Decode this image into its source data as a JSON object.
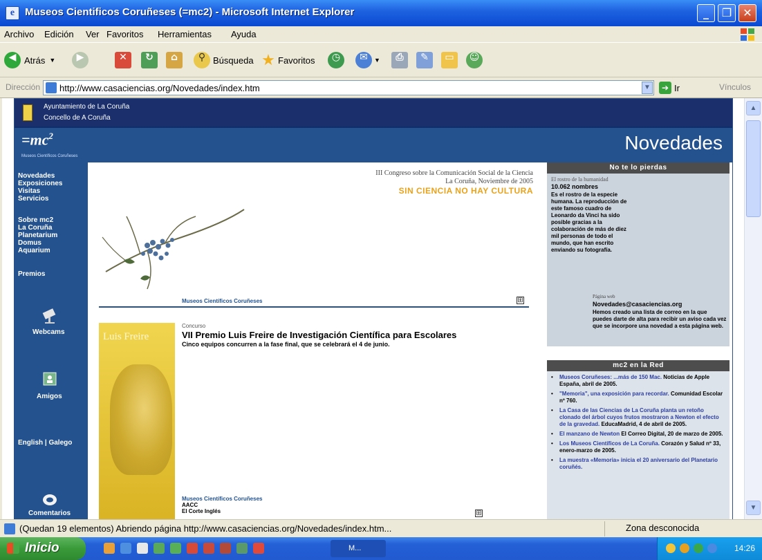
{
  "window": {
    "title": "Museos Cientificos Coruñeses (=mc2) - Microsoft Internet Explorer",
    "minimize": "_",
    "maximize": "❐",
    "close": "✕"
  },
  "menu": [
    "Archivo",
    "Edición",
    "Ver",
    "Favoritos",
    "Herramientas",
    "Ayuda"
  ],
  "toolbar": {
    "back": "Atrás",
    "search": "Búsqueda",
    "favorites": "Favoritos"
  },
  "address": {
    "label": "Dirección",
    "url": "http://www.casaciencias.org/Novedades/index.htm",
    "go": "Ir",
    "links": "Vínculos"
  },
  "site": {
    "org_line1": "Ayuntamiento de La Coruña",
    "org_line2": "Concello de A Coruña",
    "logo": "=mc",
    "logo_sup": "2",
    "logo_sub": "Museos Científicos Coruñeses",
    "page_title": "Novedades"
  },
  "nav": {
    "group1": [
      "Novedades",
      "Exposiciones",
      "Visitas",
      "Servicios"
    ],
    "group2": [
      "Sobre mc2",
      "La Coruña",
      "Planetarium",
      "Domus",
      "Aquarium"
    ],
    "premios": "Premios",
    "webcams": "Webcams",
    "amigos": "Amigos",
    "lang": "English | Galego",
    "comentarios": "Comentarios"
  },
  "main": {
    "congress_line1": "III Congreso sobre la Comunicación Social de la Ciencia",
    "congress_line2": "La Coruña, Noviembre de 2005",
    "slogan": "SIN CIENCIA NO HAY CULTURA",
    "footer1": "Museos Científicos Coruñeses",
    "poster_text": "Luis Freire",
    "kicker": "Concurso",
    "news_title": "VII Premio Luis Freire de Investigación Científica para Escolares",
    "news_desc": "Cinco equipos concurren a la fase final, que se celebrará el 4 de junio.",
    "footer2_l1": "Museos Científicos Coruñeses",
    "footer2_l2": "AACC",
    "footer2_l3": "El Corte Inglés",
    "plus": "⊞"
  },
  "sidebar": {
    "box1_title": "No te lo pierdas",
    "box1_kicker": "El rostro de la humanidad",
    "box1_number": "10.062 nombres",
    "box1_text": "Es el rostro de la especie humana. La reproducción de este famoso cuadro de Leonardo da Vinci ha sido posible gracias a la colaboración de más de diez mil personas de todo el mundo, que han escrito enviando su fotografía.",
    "web_kicker": "Página web",
    "web_email": "Novedades@casaciencias.org",
    "web_text": "Hemos creado una lista de correo en la que puedes darte de alta para recibir un aviso cada vez que se incorpore una novedad a esta página web.",
    "box2_title": "mc2 en la Red",
    "items": [
      {
        "link": "Museos Coruñeses: ...más de 150 Mac.",
        "rest": " Noticias de Apple España, abril de 2005."
      },
      {
        "link": "\"Memoria\", una exposición para recordar.",
        "rest": " Comunidad Escolar nº 760."
      },
      {
        "link": "La Casa de las Ciencias de La Coruña planta un retoño clonado del árbol cuyos frutos mostraron a Newton el efecto de la gravedad.",
        "rest": " EducaMadrid, 4 de abril de 2005."
      },
      {
        "link": "El manzano de Newton",
        "rest": " El Correo Digital, 20 de marzo de 2005."
      },
      {
        "link": "Los Museos Científicos de La Coruña.",
        "rest": " Corazón y Salud nº 33, enero-marzo de 2005."
      },
      {
        "link": "La muestra «Memoria» inicia el 20 aniversario del Planetario coruñés.",
        "rest": ""
      }
    ]
  },
  "status": {
    "text": "(Quedan 19 elementos) Abriendo página http://www.casaciencias.org/Novedades/index.htm...",
    "zone": "Zona desconocida"
  },
  "taskbar": {
    "start": "Inicio",
    "task": "M...",
    "clock": "14:26"
  }
}
